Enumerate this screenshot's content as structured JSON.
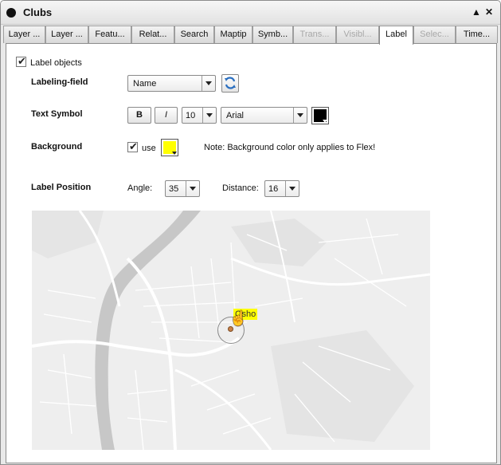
{
  "window": {
    "title": "Clubs",
    "minimize_glyph": "▲",
    "close_glyph": "✕"
  },
  "tabs": [
    {
      "label": "Layer ...",
      "state": "normal"
    },
    {
      "label": "Layer ...",
      "state": "normal"
    },
    {
      "label": "Featu...",
      "state": "normal"
    },
    {
      "label": "Relat...",
      "state": "normal"
    },
    {
      "label": "Search",
      "state": "normal"
    },
    {
      "label": "Maptip",
      "state": "normal"
    },
    {
      "label": "Symb...",
      "state": "normal"
    },
    {
      "label": "Trans...",
      "state": "disabled"
    },
    {
      "label": "Visibl...",
      "state": "disabled"
    },
    {
      "label": "Label",
      "state": "active"
    },
    {
      "label": "Selec...",
      "state": "disabled"
    },
    {
      "label": "Time...",
      "state": "normal"
    }
  ],
  "label_objects": {
    "label": "Label objects",
    "checked": true
  },
  "labeling_field": {
    "label": "Labeling-field",
    "value": "Name",
    "refresh_icon": "refresh-icon"
  },
  "text_symbol": {
    "label": "Text Symbol",
    "bold_label": "B",
    "italic_label": "I",
    "size": "10",
    "font": "Arial",
    "color": "#000000"
  },
  "background": {
    "label": "Background",
    "use_label": "use",
    "use_checked": true,
    "color": "#ffff00",
    "note": "Note: Background color only applies to Flex!"
  },
  "label_position": {
    "label": "Label Position",
    "angle_label": "Angle:",
    "angle": "35",
    "distance_label": "Distance:",
    "distance": "16"
  },
  "preview": {
    "label_text": "Osho",
    "label_bg": "#ffff00",
    "point_color": "#c8804a"
  }
}
